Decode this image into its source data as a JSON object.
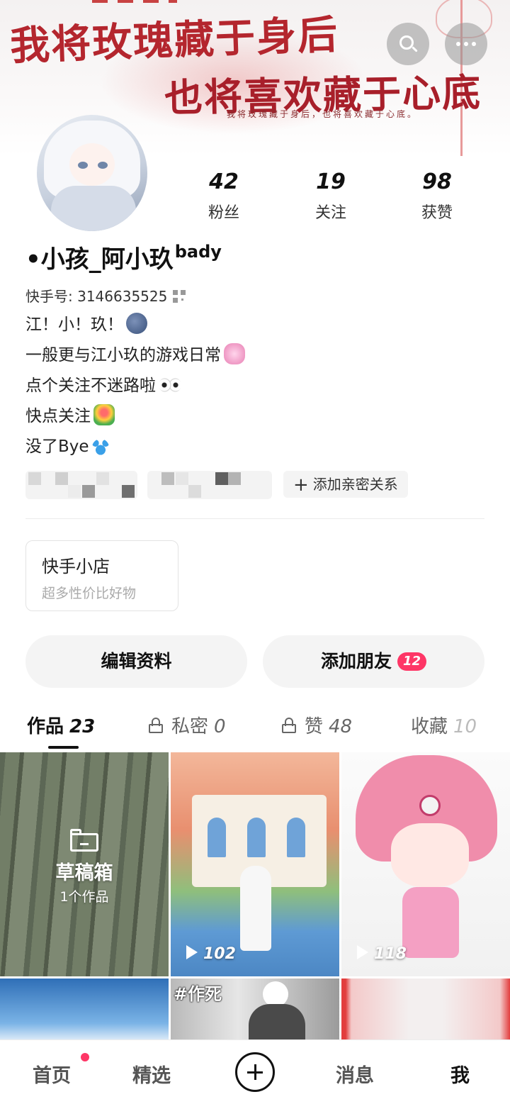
{
  "banner": {
    "line1": "我将玫瑰藏于身后",
    "line2": "也将喜欢藏于心底",
    "subline": "我将玫瑰藏于身后，也将喜欢藏于心底。"
  },
  "header_buttons": {
    "search_icon": "search-icon",
    "more_icon": "more-icon"
  },
  "stats": {
    "fans": {
      "value": "42",
      "label": "粉丝"
    },
    "following": {
      "value": "19",
      "label": "关注"
    },
    "likes": {
      "value": "98",
      "label": "获赞"
    }
  },
  "profile": {
    "name": "•小孩_阿小玖",
    "name_suffix": "bady",
    "kuaishou_id": "快手号: 3146635525",
    "bio": {
      "line1": "江！小！玖！",
      "line2": "一般更与江小玖的游戏日常",
      "line3": "点个关注不迷路啦",
      "line4": "快点关注",
      "line5": "没了Bye"
    }
  },
  "tags": {
    "add_relation": "添加亲密关系"
  },
  "shop": {
    "title": "快手小店",
    "subtitle": "超多性价比好物"
  },
  "actions": {
    "edit_profile": "编辑资料",
    "add_friends": "添加朋友",
    "add_friends_badge": "12"
  },
  "tabs": {
    "works": {
      "label": "作品",
      "count": "23"
    },
    "private": {
      "label": "私密",
      "count": "0"
    },
    "liked": {
      "label": "赞",
      "count": "48"
    },
    "favorites": {
      "label": "收藏",
      "count": "10"
    }
  },
  "grid": {
    "draft_title": "草稿箱",
    "draft_count": "1个作品",
    "video2_plays": "102",
    "video3_plays": "118",
    "video5_hashtag": "#作死"
  },
  "bottom_nav": {
    "home": "首页",
    "featured": "精选",
    "messages": "消息",
    "me": "我"
  },
  "colors": {
    "accent": "#fe3666",
    "banner_text": "#b4262e"
  }
}
